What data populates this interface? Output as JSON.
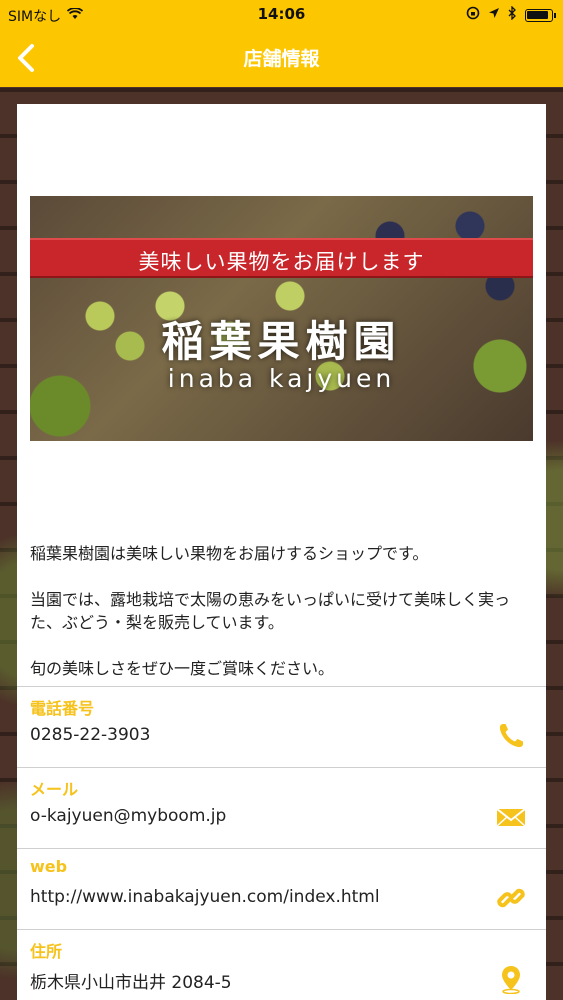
{
  "status_bar": {
    "carrier": "SIMなし",
    "time": "14:06"
  },
  "nav": {
    "title": "店舗情報"
  },
  "banner": {
    "ribbon_text": "美味しい果物をお届けします",
    "title": "稲葉果樹園",
    "subtitle": "inaba kajyuen"
  },
  "description": [
    "稲葉果樹園は美味しい果物をお届けするショップです。",
    "当園では、露地栽培で太陽の恵みをいっぱいに受けて美味しく実った、ぶどう・梨を販売しています。",
    "旬の美味しさをぜひ一度ご賞味ください。"
  ],
  "info": {
    "phone": {
      "label": "電話番号",
      "value": "0285-22-3903",
      "icon": "phone-icon"
    },
    "mail": {
      "label": "メール",
      "value": "o-kajyuen@myboom.jp",
      "icon": "mail-icon"
    },
    "web": {
      "label": "web",
      "value": "http://www.inabakajyuen.com/index.html",
      "icon": "link-icon"
    },
    "address": {
      "label": "住所",
      "value": "栃木県小山市出井 2084-5",
      "icon": "map-pin-icon"
    }
  },
  "colors": {
    "accent": "#fcc600",
    "label": "#f6c21c",
    "ribbon": "#c8262a"
  }
}
